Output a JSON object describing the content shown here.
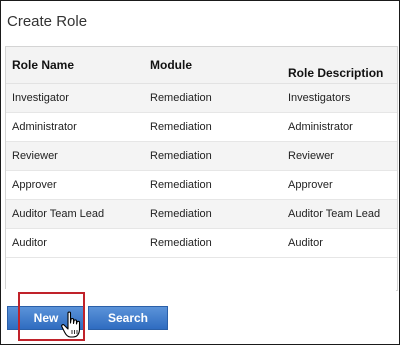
{
  "title": "Create Role",
  "columns": {
    "name": "Role Name",
    "module": "Module",
    "description": "Role Description"
  },
  "rows": [
    {
      "name": "Investigator",
      "module": "Remediation",
      "description": "Investigators"
    },
    {
      "name": "Administrator",
      "module": "Remediation",
      "description": "Administrator"
    },
    {
      "name": "Reviewer",
      "module": "Remediation",
      "description": "Reviewer"
    },
    {
      "name": "Approver",
      "module": "Remediation",
      "description": "Approver"
    },
    {
      "name": "Auditor Team Lead",
      "module": "Remediation",
      "description": "Auditor Team Lead"
    },
    {
      "name": "Auditor",
      "module": "Remediation",
      "description": "Auditor"
    }
  ],
  "buttons": {
    "new_label": "New",
    "search_label": "Search"
  },
  "colors": {
    "button": "#2f6cc0",
    "highlight": "#c0222a"
  },
  "icons": {
    "cursor": "hand-pointer-icon"
  }
}
